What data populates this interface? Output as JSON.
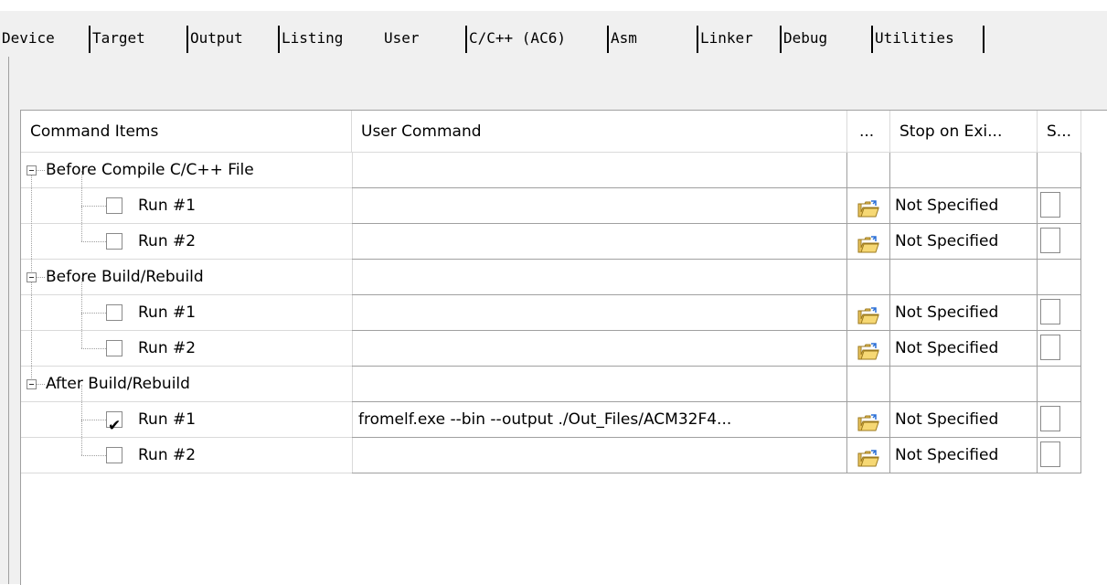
{
  "tabs": [
    {
      "label": "Device"
    },
    {
      "label": "Target"
    },
    {
      "label": "Output"
    },
    {
      "label": "Listing"
    },
    {
      "label": "User"
    },
    {
      "label": "C/C++ (AC6)"
    },
    {
      "label": "Asm"
    },
    {
      "label": "Linker"
    },
    {
      "label": "Debug"
    },
    {
      "label": "Utilities"
    }
  ],
  "grid": {
    "headers": {
      "command_items": "Command Items",
      "user_command": "User Command",
      "browse": "...",
      "stop_on_exit": "Stop on Exi...",
      "s": "S..."
    },
    "groups": [
      {
        "label": "Before Compile C/C++ File",
        "runs": [
          {
            "label": "Run #1",
            "checked": false,
            "command": "",
            "stop": "Not Specified"
          },
          {
            "label": "Run #2",
            "checked": false,
            "command": "",
            "stop": "Not Specified"
          }
        ]
      },
      {
        "label": "Before Build/Rebuild",
        "runs": [
          {
            "label": "Run #1",
            "checked": false,
            "command": "",
            "stop": "Not Specified"
          },
          {
            "label": "Run #2",
            "checked": false,
            "command": "",
            "stop": "Not Specified"
          }
        ]
      },
      {
        "label": "After Build/Rebuild",
        "runs": [
          {
            "label": "Run #1",
            "checked": true,
            "command": "fromelf.exe --bin --output ./Out_Files/ACM32F4...",
            "stop": "Not Specified"
          },
          {
            "label": "Run #2",
            "checked": false,
            "command": "",
            "stop": "Not Specified"
          }
        ]
      }
    ]
  },
  "icons": {
    "browse": "folder-open-icon",
    "expander": "tree-collapse-icon"
  }
}
